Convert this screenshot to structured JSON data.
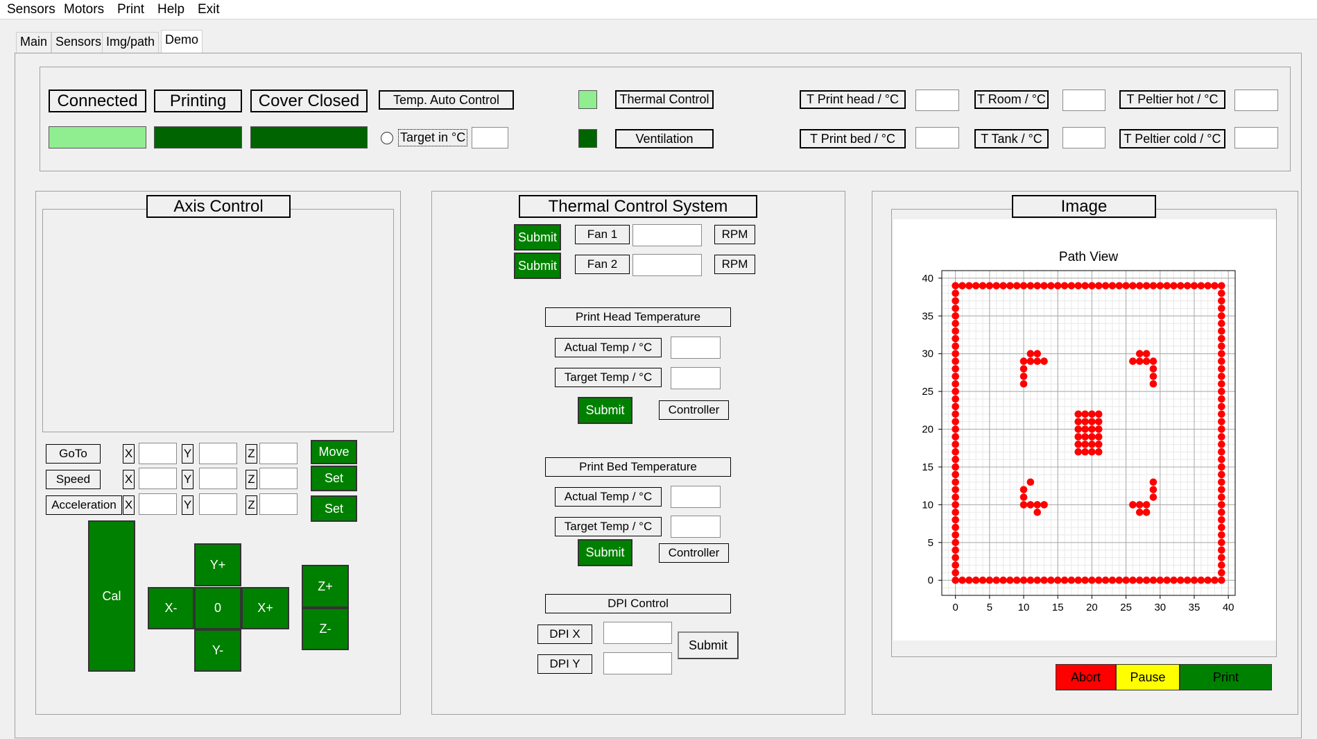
{
  "menu": [
    "Sensors",
    "Motors",
    "Print",
    "Help",
    "Exit"
  ],
  "tabs": [
    "Main",
    "Sensors",
    "Img/path",
    "Demo"
  ],
  "status": {
    "connected": "Connected",
    "printing": "Printing",
    "cover": "Cover Closed",
    "temp_auto": "Temp. Auto Control",
    "target": "Target in °C",
    "thermal": "Thermal Control",
    "ventilation": "Ventilation",
    "t_head": "T Print head / °C",
    "t_bed": "T Print bed / °C",
    "t_room": "T Room / °C",
    "t_tank": "T Tank / °C",
    "t_pelt_hot": "T Peltier hot / °C",
    "t_pelt_cold": "T Peltier cold / °C",
    "colors": {
      "light": "#90ee90",
      "dark": "#006400"
    }
  },
  "axis": {
    "title": "Axis Control",
    "goto": "GoTo",
    "speed": "Speed",
    "accel": "Acceleration",
    "x": "X",
    "y": "Y",
    "z": "Z",
    "move": "Move",
    "set": "Set",
    "cal": "Cal",
    "yplus": "Y+",
    "yminus": "Y-",
    "xminus": "X-",
    "xplus": "X+",
    "zero": "0",
    "zplus": "Z+",
    "zminus": "Z-"
  },
  "thermal": {
    "title": "Thermal Control System",
    "submit": "Submit",
    "fan1": "Fan 1",
    "fan2": "Fan 2",
    "rpm": "RPM",
    "head_title": "Print Head Temperature",
    "bed_title": "Print Bed Temperature",
    "actual": "Actual Temp / °C",
    "target": "Target Temp / °C",
    "controller": "Controller",
    "dpi_title": "DPI Control",
    "dpi_x": "DPI X",
    "dpi_y": "DPI Y"
  },
  "image": {
    "title": "Image",
    "abort": "Abort",
    "pause": "Pause",
    "print": "Print",
    "colors": {
      "abort": "#ff0000",
      "pause": "#ffff00",
      "print": "#008000"
    }
  },
  "chart_data": {
    "type": "scatter",
    "title": "Path View",
    "xlim": [
      -2,
      41
    ],
    "ylim": [
      -2,
      41
    ],
    "xticks": [
      0,
      5,
      10,
      15,
      20,
      25,
      30,
      35,
      40
    ],
    "yticks": [
      0,
      5,
      10,
      15,
      20,
      25,
      30,
      35,
      40
    ],
    "grid": true,
    "marker_color": "#ff0000",
    "description_points": {
      "border": {
        "x_range": [
          0,
          39
        ],
        "y_range": [
          0,
          39
        ]
      },
      "corner_marks": [
        {
          "x": [
            10,
            10,
            10,
            10,
            11,
            11,
            12,
            12,
            13
          ],
          "y": [
            26,
            27,
            28,
            29,
            29,
            30,
            30,
            29,
            29
          ]
        },
        {
          "x": [
            26,
            27,
            28,
            28,
            29,
            29,
            29,
            29,
            27
          ],
          "y": [
            29,
            29,
            29,
            30,
            28,
            27,
            26,
            29,
            30
          ]
        },
        {
          "x": [
            10,
            10,
            10,
            11,
            11,
            12,
            12,
            13
          ],
          "y": [
            10,
            11,
            12,
            13,
            10,
            9,
            10,
            10
          ]
        },
        {
          "x": [
            26,
            27,
            28,
            28,
            29,
            29,
            29,
            27
          ],
          "y": [
            10,
            10,
            10,
            9,
            11,
            12,
            13,
            9
          ]
        }
      ],
      "center_block": {
        "x_range": [
          18,
          21
        ],
        "y_range": [
          17,
          22
        ]
      }
    }
  }
}
